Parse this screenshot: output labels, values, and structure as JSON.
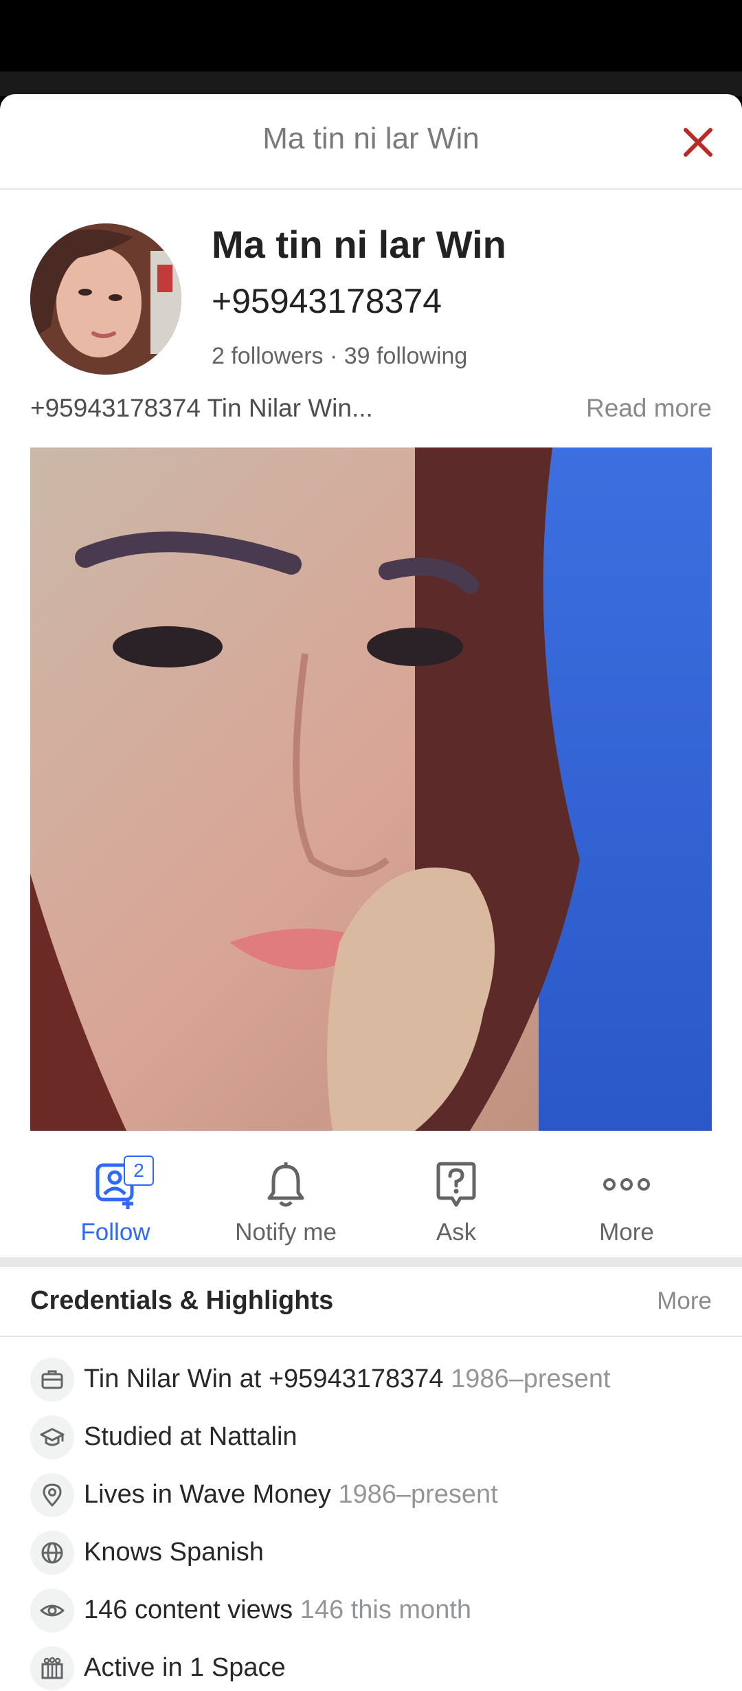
{
  "header": {
    "title": "Ma tin ni lar Win"
  },
  "profile": {
    "name": "Ma tin ni lar Win",
    "phone": "+95943178374",
    "followers": "2 followers",
    "separator": "·",
    "following": "39 following",
    "bio": "+95943178374 Tin Nilar Win...",
    "read_more": "Read more"
  },
  "actions": {
    "follow_label": "Follow",
    "follow_count": "2",
    "notify_label": "Notify me",
    "ask_label": "Ask",
    "more_label": "More"
  },
  "credentials": {
    "title": "Credentials & Highlights",
    "more_label": "More",
    "items": [
      {
        "icon": "briefcase-icon",
        "text": "Tin Nilar Win at +95943178374",
        "sub": "1986–present"
      },
      {
        "icon": "graduation-cap-icon",
        "text": "Studied at Nattalin",
        "sub": ""
      },
      {
        "icon": "location-pin-icon",
        "text": "Lives in Wave Money",
        "sub": "1986–present"
      },
      {
        "icon": "globe-icon",
        "text": "Knows Spanish",
        "sub": ""
      },
      {
        "icon": "eye-icon",
        "text": "146 content views",
        "sub": "146 this month"
      },
      {
        "icon": "spaces-icon",
        "text": "Active in 1 Space",
        "sub": ""
      }
    ]
  },
  "colors": {
    "accent": "#2e69ff",
    "close": "#b92b27",
    "muted": "#939598"
  }
}
